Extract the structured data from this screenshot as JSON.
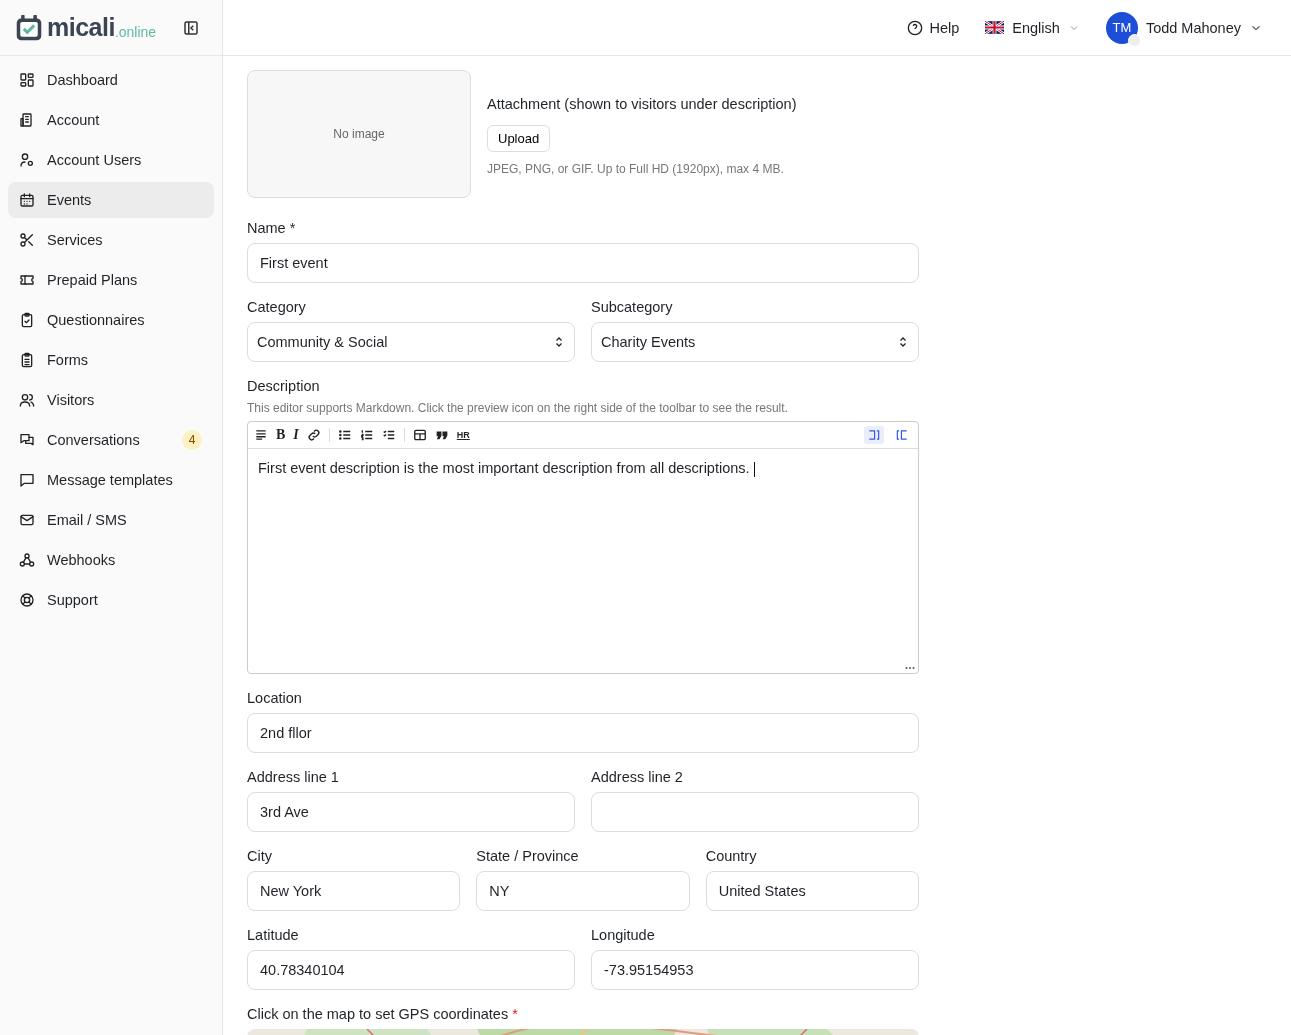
{
  "brand": {
    "name": "micali",
    "suffix": ".online"
  },
  "sidebar": {
    "items": [
      {
        "label": "Dashboard",
        "selected": false
      },
      {
        "label": "Account",
        "selected": false
      },
      {
        "label": "Account Users",
        "selected": false
      },
      {
        "label": "Events",
        "selected": true
      },
      {
        "label": "Services",
        "selected": false
      },
      {
        "label": "Prepaid Plans",
        "selected": false
      },
      {
        "label": "Questionnaires",
        "selected": false
      },
      {
        "label": "Forms",
        "selected": false
      },
      {
        "label": "Visitors",
        "selected": false
      },
      {
        "label": "Conversations",
        "selected": false,
        "badge": "4"
      },
      {
        "label": "Message templates",
        "selected": false
      },
      {
        "label": "Email / SMS",
        "selected": false
      },
      {
        "label": "Webhooks",
        "selected": false
      },
      {
        "label": "Support",
        "selected": false
      }
    ]
  },
  "header": {
    "help": "Help",
    "language": "English",
    "user": {
      "initials": "TM",
      "name": "Todd Mahoney"
    }
  },
  "attachment": {
    "empty_text": "No image",
    "title": "Attachment (shown to visitors under description)",
    "button": "Upload",
    "hint": "JPEG, PNG, or GIF. Up to Full HD (1920px), max 4 MB."
  },
  "name_field": {
    "label": "Name",
    "mark": "*",
    "value": "First event"
  },
  "category_row": [
    {
      "label": "Category",
      "value": "Community & Social"
    },
    {
      "label": "Subcategory",
      "value": "Charity Events"
    }
  ],
  "description": {
    "label": "Description",
    "hint": "This editor supports Markdown. Click the preview icon on the right side of the toolbar to see the result.",
    "toolbar": [
      {
        "kind": "heading"
      },
      {
        "kind": "bold",
        "label": "B"
      },
      {
        "kind": "italic",
        "label": "I"
      },
      {
        "kind": "link"
      },
      {
        "kind": "separator"
      },
      {
        "kind": "bullets"
      },
      {
        "kind": "numbers"
      },
      {
        "kind": "tasks"
      },
      {
        "kind": "separator"
      },
      {
        "kind": "table"
      },
      {
        "kind": "quote"
      },
      {
        "kind": "rule",
        "label": "HR"
      }
    ],
    "view_buttons": [
      {
        "kind": "split",
        "selected": true
      },
      {
        "kind": "preview",
        "selected": false
      }
    ],
    "value": "First event description is the most important description from all descriptions."
  },
  "location_rows": [
    [
      {
        "label": "Location",
        "value": "2nd fllor"
      }
    ],
    [
      {
        "label": "Address line 1",
        "value": "3rd Ave"
      },
      {
        "label": "Address line 2"
      }
    ],
    [
      {
        "label": "City",
        "value": "New York"
      },
      {
        "label": "State / Province",
        "value": "NY"
      },
      {
        "label": "Country",
        "value": "United States"
      }
    ],
    [
      {
        "label": "Latitude",
        "value": "40.78340104"
      },
      {
        "label": "Longitude",
        "value": "-73.95154953"
      }
    ]
  ],
  "map": {
    "label": "Click on the map to set GPS coordinates",
    "mark": "*",
    "kind": "picture"
  }
}
